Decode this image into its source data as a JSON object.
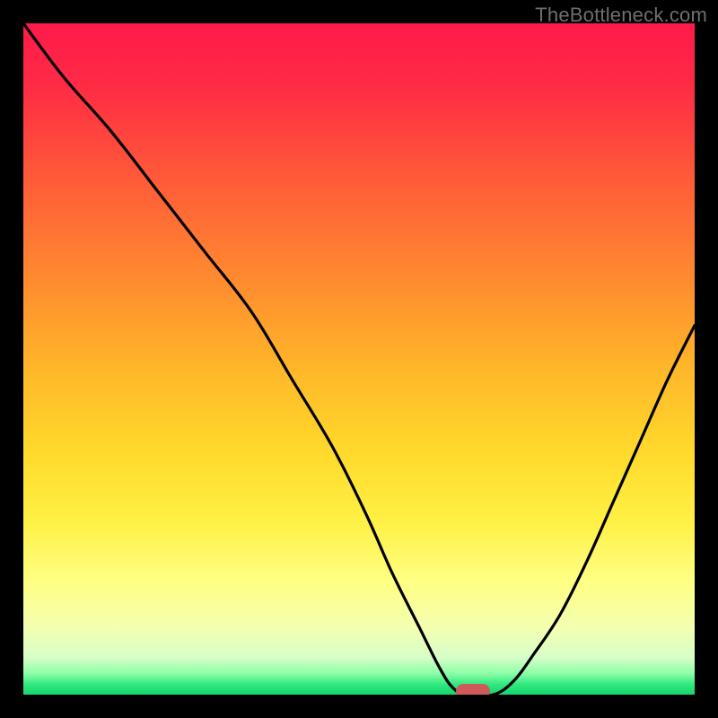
{
  "watermark": "TheBottleneck.com",
  "colors": {
    "background_black": "#000000",
    "gradient_stops": [
      {
        "offset": 0.0,
        "color": "#ff1a4a"
      },
      {
        "offset": 0.1,
        "color": "#ff2d44"
      },
      {
        "offset": 0.23,
        "color": "#ff5a39"
      },
      {
        "offset": 0.38,
        "color": "#ff8a2f"
      },
      {
        "offset": 0.52,
        "color": "#ffb829"
      },
      {
        "offset": 0.64,
        "color": "#ffda2b"
      },
      {
        "offset": 0.74,
        "color": "#fff044"
      },
      {
        "offset": 0.83,
        "color": "#ffff82"
      },
      {
        "offset": 0.9,
        "color": "#f4ffb0"
      },
      {
        "offset": 0.945,
        "color": "#d6ffc8"
      },
      {
        "offset": 0.968,
        "color": "#8effa8"
      },
      {
        "offset": 0.985,
        "color": "#2fe87e"
      },
      {
        "offset": 1.0,
        "color": "#18d46e"
      }
    ],
    "curve": "#000000",
    "marker_fill": "#cf5a5a",
    "watermark_text": "#6f6f6f"
  },
  "chart_data": {
    "type": "line",
    "title": "",
    "xlabel": "",
    "ylabel": "",
    "xlim": [
      0,
      100
    ],
    "ylim": [
      0,
      100
    ],
    "x": [
      0,
      6,
      13,
      20,
      27,
      34,
      40,
      46,
      51,
      55,
      59,
      62,
      64,
      66,
      70,
      73,
      76,
      80,
      84,
      88,
      92,
      96,
      100
    ],
    "values": [
      100,
      92,
      84,
      75,
      66,
      57,
      47,
      37,
      27,
      18,
      10,
      4,
      1,
      0,
      0,
      2,
      6,
      12,
      20,
      29,
      38,
      47,
      55
    ],
    "series": [
      {
        "name": "bottleneck_curve",
        "x": [
          0,
          6,
          13,
          20,
          27,
          34,
          40,
          46,
          51,
          55,
          59,
          62,
          64,
          66,
          70,
          73,
          76,
          80,
          84,
          88,
          92,
          96,
          100
        ],
        "values": [
          100,
          92,
          84,
          75,
          66,
          57,
          47,
          37,
          27,
          18,
          10,
          4,
          1,
          0,
          0,
          2,
          6,
          12,
          20,
          29,
          38,
          47,
          55
        ]
      }
    ],
    "marker": {
      "x": 67,
      "y": 0.5
    }
  }
}
